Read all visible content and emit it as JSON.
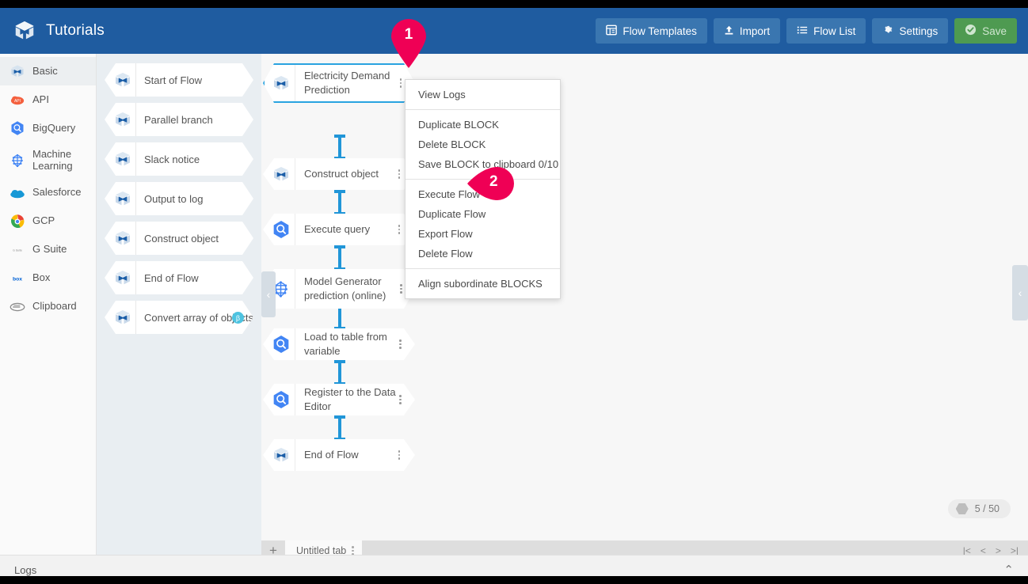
{
  "header": {
    "title": "Tutorials",
    "logo_icon": "trocco-box-logo-icon",
    "buttons": [
      {
        "label": "Flow Templates",
        "icon": "list-panel-icon"
      },
      {
        "label": "Import",
        "icon": "upload-icon"
      },
      {
        "label": "Flow List",
        "icon": "list-icon"
      },
      {
        "label": "Settings",
        "icon": "gear-icon"
      },
      {
        "label": "Save",
        "icon": "check-circle-icon"
      }
    ],
    "accent_color": "#1f5ca0",
    "button_color": "#3a76b0",
    "save_color": "#4e9a51"
  },
  "sidebar": {
    "items": [
      {
        "label": "Basic",
        "icon": "basic-block-icon",
        "active": true
      },
      {
        "label": "API",
        "icon": "api-cloud-icon",
        "active": false
      },
      {
        "label": "BigQuery",
        "icon": "bigquery-icon",
        "active": false
      },
      {
        "label": "Machine Learning",
        "icon": "machine-learning-brain-icon",
        "active": false
      },
      {
        "label": "Salesforce",
        "icon": "salesforce-cloud-icon",
        "active": false
      },
      {
        "label": "GCP",
        "icon": "gcp-icon",
        "active": false
      },
      {
        "label": "G Suite",
        "icon": "gsuite-icon",
        "active": false
      },
      {
        "label": "Box",
        "icon": "box-icon",
        "active": false
      },
      {
        "label": "Clipboard",
        "icon": "clipboard-icon",
        "active": false
      }
    ]
  },
  "palette": {
    "items": [
      {
        "label": "Start of Flow",
        "icon": "basic-block-icon",
        "badge": ""
      },
      {
        "label": "Parallel branch",
        "icon": "basic-block-icon",
        "badge": ""
      },
      {
        "label": "Slack notice",
        "icon": "basic-block-icon",
        "badge": ""
      },
      {
        "label": "Output to log",
        "icon": "basic-block-icon",
        "badge": ""
      },
      {
        "label": "Construct object",
        "icon": "basic-block-icon",
        "badge": ""
      },
      {
        "label": "End of Flow",
        "icon": "basic-block-icon",
        "badge": ""
      },
      {
        "label": "Convert array of objects",
        "icon": "basic-block-icon",
        "badge": "β"
      }
    ]
  },
  "canvas": {
    "nodes": [
      {
        "label": "Electricity Demand Prediction",
        "icon": "basic-block-icon",
        "selected": true
      },
      {
        "label": "Construct object",
        "icon": "basic-block-icon",
        "selected": false
      },
      {
        "label": "Execute query",
        "icon": "bigquery-icon",
        "selected": false
      },
      {
        "label": "Model Generator prediction (online)",
        "icon": "machine-learning-brain-icon",
        "selected": false
      },
      {
        "label": "Load to table from variable",
        "icon": "bigquery-icon",
        "selected": false
      },
      {
        "label": "Register to the Data Editor",
        "icon": "bigquery-icon",
        "selected": false
      },
      {
        "label": "End of Flow",
        "icon": "basic-block-icon",
        "selected": false
      }
    ],
    "counter": "5 / 50",
    "left_handle_icon": "chevron-left-icon",
    "right_handle_icon": "chevron-left-icon"
  },
  "context_menu": {
    "groups": [
      {
        "items": [
          "View Logs"
        ]
      },
      {
        "items": [
          "Duplicate BLOCK",
          "Delete BLOCK",
          "Save BLOCK to clipboard 0/10"
        ]
      },
      {
        "items": [
          "Execute Flow",
          "Duplicate Flow",
          "Export Flow",
          "Delete Flow"
        ]
      },
      {
        "items": [
          "Align subordinate BLOCKS"
        ]
      }
    ]
  },
  "markers": [
    {
      "number": "1",
      "color": "#ef0055"
    },
    {
      "number": "2",
      "color": "#ef0055"
    }
  ],
  "tabbar": {
    "add_label": "+",
    "tabs": [
      {
        "label": "Untitled tab"
      }
    ],
    "pager": [
      "|<",
      "<",
      ">",
      ">|"
    ]
  },
  "logs": {
    "label": "Logs",
    "chevron_icon": "chevron-up-icon"
  }
}
